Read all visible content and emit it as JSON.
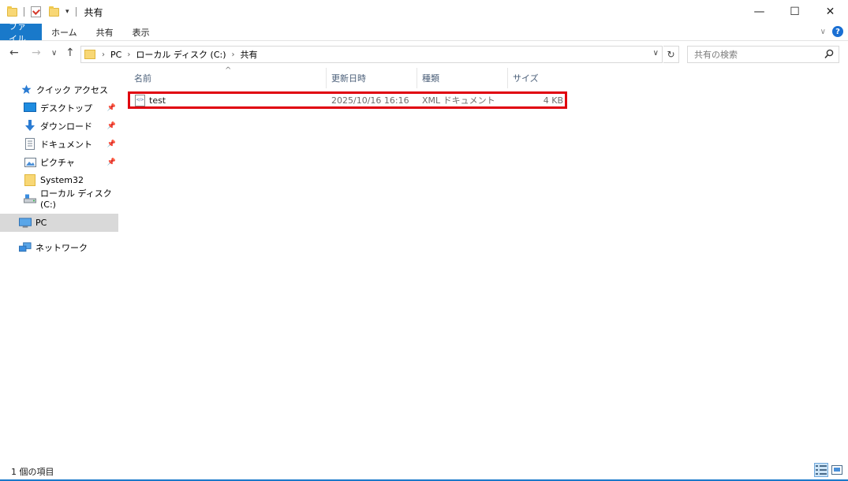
{
  "window": {
    "title": "共有",
    "controls": {
      "minimize": "—",
      "maximize": "☐",
      "close": "✕"
    }
  },
  "ribbon": {
    "tabs": [
      "ファイル",
      "ホーム",
      "共有",
      "表示"
    ],
    "help": "?"
  },
  "address": {
    "crumbs": [
      "PC",
      "ローカル ディスク (C:)",
      "共有"
    ],
    "search_placeholder": "共有の検索"
  },
  "sidebar": {
    "items": [
      {
        "label": "クイック アクセス",
        "icon": "star-icon",
        "pinned": false
      },
      {
        "label": "デスクトップ",
        "icon": "desktop-icon",
        "pinned": true
      },
      {
        "label": "ダウンロード",
        "icon": "download-icon",
        "pinned": true
      },
      {
        "label": "ドキュメント",
        "icon": "document-icon",
        "pinned": true
      },
      {
        "label": "ピクチャ",
        "icon": "picture-icon",
        "pinned": true
      },
      {
        "label": "System32",
        "icon": "folder-icon",
        "pinned": false
      },
      {
        "label": "ローカル ディスク (C:)",
        "icon": "drive-icon",
        "pinned": false
      },
      {
        "label": "PC",
        "icon": "pc-icon",
        "pinned": false,
        "selected": true
      },
      {
        "label": "ネットワーク",
        "icon": "network-icon",
        "pinned": false
      }
    ]
  },
  "columns": [
    "名前",
    "更新日時",
    "種類",
    "サイズ"
  ],
  "files": [
    {
      "name": "test",
      "modified": "2025/10/16 16:16",
      "type": "XML ドキュメント",
      "size": "4 KB",
      "icon": "xml-file-icon"
    }
  ],
  "status": {
    "item_count": "1 個の項目"
  },
  "colors": {
    "accent": "#1979ca",
    "highlight_border": "#e0000e",
    "selected_bg": "#d9d9d9"
  }
}
